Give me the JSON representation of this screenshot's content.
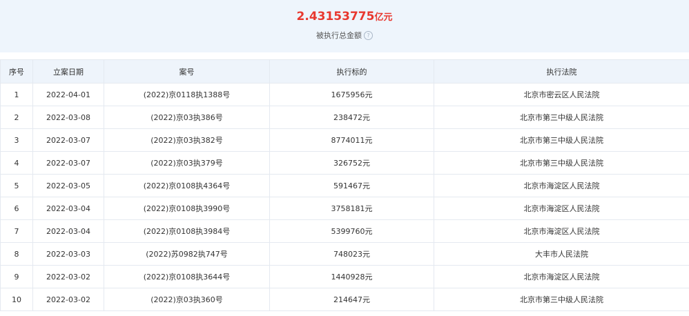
{
  "summary": {
    "amount_value": "2.43153775",
    "amount_unit": "亿元",
    "caption": "被执行总金额",
    "help_glyph": "?"
  },
  "table": {
    "headers": {
      "index": "序号",
      "date": "立案日期",
      "case_no": "案号",
      "target": "执行标的",
      "court": "执行法院"
    },
    "rows": [
      {
        "index": "1",
        "date": "2022-04-01",
        "case_no": "(2022)京0118执1388号",
        "target": "1675956元",
        "court": "北京市密云区人民法院"
      },
      {
        "index": "2",
        "date": "2022-03-08",
        "case_no": "(2022)京03执386号",
        "target": "238472元",
        "court": "北京市第三中级人民法院"
      },
      {
        "index": "3",
        "date": "2022-03-07",
        "case_no": "(2022)京03执382号",
        "target": "8774011元",
        "court": "北京市第三中级人民法院"
      },
      {
        "index": "4",
        "date": "2022-03-07",
        "case_no": "(2022)京03执379号",
        "target": "326752元",
        "court": "北京市第三中级人民法院"
      },
      {
        "index": "5",
        "date": "2022-03-05",
        "case_no": "(2022)京0108执4364号",
        "target": "591467元",
        "court": "北京市海淀区人民法院"
      },
      {
        "index": "6",
        "date": "2022-03-04",
        "case_no": "(2022)京0108执3990号",
        "target": "3758181元",
        "court": "北京市海淀区人民法院"
      },
      {
        "index": "7",
        "date": "2022-03-04",
        "case_no": "(2022)京0108执3984号",
        "target": "5399760元",
        "court": "北京市海淀区人民法院"
      },
      {
        "index": "8",
        "date": "2022-03-03",
        "case_no": "(2022)苏0982执747号",
        "target": "748023元",
        "court": "大丰市人民法院"
      },
      {
        "index": "9",
        "date": "2022-03-02",
        "case_no": "(2022)京0108执3644号",
        "target": "1440928元",
        "court": "北京市海淀区人民法院"
      },
      {
        "index": "10",
        "date": "2022-03-02",
        "case_no": "(2022)京03执360号",
        "target": "214647元",
        "court": "北京市第三中级人民法院"
      }
    ]
  }
}
